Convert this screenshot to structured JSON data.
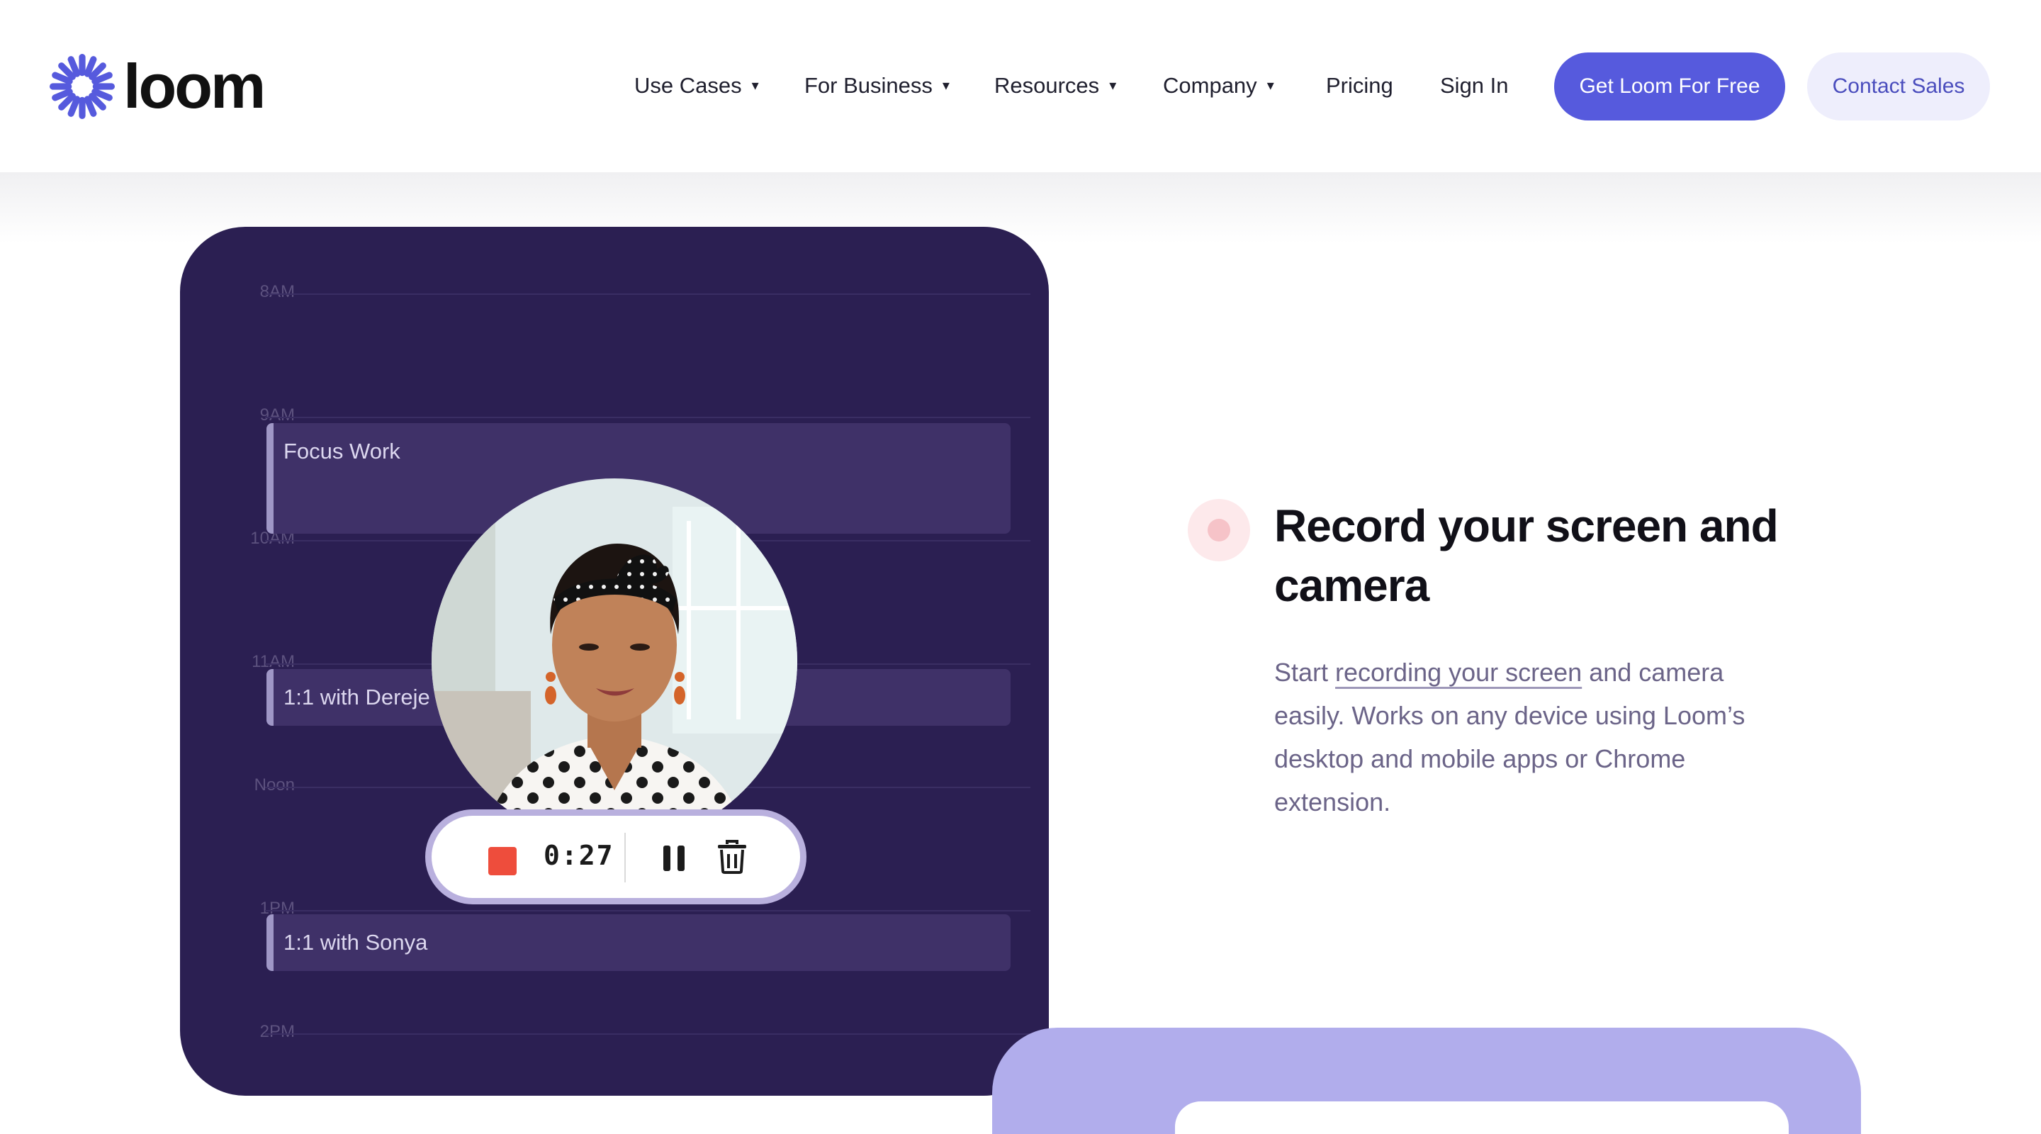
{
  "brand": {
    "name": "loom",
    "color": "#565add"
  },
  "nav": {
    "items": [
      {
        "label": "Use Cases",
        "has_dropdown": true,
        "caret": "▾"
      },
      {
        "label": "For Business",
        "has_dropdown": true,
        "caret": "▾"
      },
      {
        "label": "Resources",
        "has_dropdown": true,
        "caret": "▾"
      },
      {
        "label": "Company",
        "has_dropdown": true,
        "caret": "▾"
      },
      {
        "label": "Pricing",
        "has_dropdown": false
      },
      {
        "label": "Sign In",
        "has_dropdown": false
      }
    ],
    "cta_primary": "Get Loom For Free",
    "cta_secondary": "Contact Sales"
  },
  "calendar": {
    "hours": [
      "8AM",
      "9AM",
      "10AM",
      "11AM",
      "Noon",
      "1PM",
      "2PM"
    ],
    "events": [
      {
        "title": "Focus Work"
      },
      {
        "title": "1:1 with Dereje"
      },
      {
        "title": "1:1 with Sonya"
      }
    ],
    "recorder": {
      "time": "0:27",
      "stop_icon": "stop-icon",
      "pause_icon": "pause-icon",
      "delete_icon": "trash-icon",
      "stop_color": "#ee4d3c"
    }
  },
  "feature": {
    "title": "Record your screen and camera",
    "body_prefix": "Start ",
    "body_link": "recording your screen",
    "body_suffix": " and camera easily. Works on any device using Loom’s desktop and mobile apps or Chrome extension."
  }
}
